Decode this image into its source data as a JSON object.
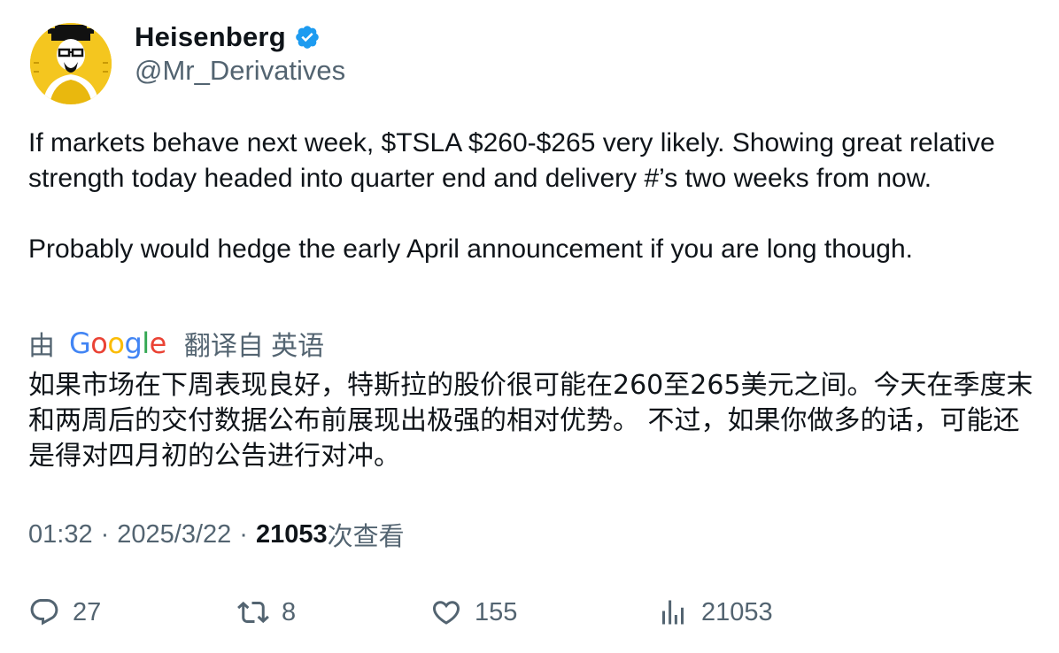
{
  "author": {
    "display_name": "Heisenberg",
    "handle": "@Mr_Derivatives",
    "verified": true,
    "verified_color": "#1d9bf0",
    "avatar_icon": "heisenberg-avatar-icon"
  },
  "tweet": {
    "text": "If markets behave next week, $TSLA $260-$265 very likely. Showing great relative strength today headed into quarter end and delivery #’s two weeks from now.\n\nProbably would hedge the early April announcement if you are long though."
  },
  "translation": {
    "by_label": "由",
    "provider": "Google",
    "from_label": "翻译自 英语",
    "text": "如果市场在下周表现良好，特斯拉的股价很可能在260至265美元之间。今天在季度末和两周后的交付数据公布前展现出极强的相对优势。 不过，如果你做多的话，可能还是得对四月初的公告进行对冲。"
  },
  "meta": {
    "time": "01:32",
    "separator": "·",
    "date": "2025/3/22",
    "views_count": "21053",
    "views_label": "次查看"
  },
  "actions": {
    "reply_count": "27",
    "retweet_count": "8",
    "like_count": "155",
    "views_count": "21053"
  },
  "colors": {
    "primary_text": "#0f1419",
    "secondary_text": "#536471",
    "google_blue": "#4285F4",
    "google_red": "#EA4335",
    "google_yellow": "#FBBC05",
    "google_green": "#34A853"
  }
}
